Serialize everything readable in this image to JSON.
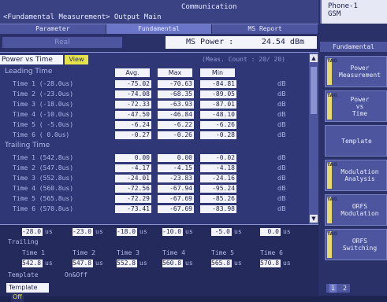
{
  "header": {
    "communication": "Communication",
    "title": "<Fundamental Measurement> Output Main",
    "phone_line1": "Phone-1",
    "phone_line2": "GSM"
  },
  "tabs": [
    "Parameter",
    "Fundamental",
    "MS Report"
  ],
  "ms_bar": {
    "box_label": "Real",
    "power_label": "MS Power :",
    "power_value": "24.54 dBm"
  },
  "main": {
    "pvt_label": "Power vs Time",
    "view_label": "View",
    "meas_count": "(Meas. Count :    20/  20)",
    "columns": [
      "Avg.",
      "Max",
      "Min"
    ],
    "leading_title": "Leading Time",
    "trailing_title": "Trailing Time",
    "unit": "dB",
    "leading_rows": [
      {
        "label": "Time 1 (-28.0us)",
        "avg": "-75.02",
        "max": "-70.63",
        "min": "-84.81"
      },
      {
        "label": "Time 2 (-23.0us)",
        "avg": "-74.08",
        "max": "-68.35",
        "min": "-89.05"
      },
      {
        "label": "Time 3 (-18.0us)",
        "avg": "-72.33",
        "max": "-63.93",
        "min": "-87.01"
      },
      {
        "label": "Time 4 (-10.0us)",
        "avg": "-47.50",
        "max": "-46.84",
        "min": "-48.10"
      },
      {
        "label": "Time 5 ( -5.0us)",
        "avg": "-6.24",
        "max": "-6.22",
        "min": "-6.26"
      },
      {
        "label": "Time 6 (  0.0us)",
        "avg": "-0.27",
        "max": "-0.26",
        "min": "-0.28"
      }
    ],
    "trailing_rows": [
      {
        "label": "Time 1 (542.8us)",
        "avg": "0.00",
        "max": "0.00",
        "min": "-0.02"
      },
      {
        "label": "Time 2 (547.8us)",
        "avg": "-4.17",
        "max": "-4.15",
        "min": "-4.18"
      },
      {
        "label": "Time 3 (552.8us)",
        "avg": "-24.01",
        "max": "-23.83",
        "min": "-24.16"
      },
      {
        "label": "Time 4 (560.8us)",
        "avg": "-72.56",
        "max": "-67.94",
        "min": "-95.24"
      },
      {
        "label": "Time 5 (565.8us)",
        "avg": "-72.29",
        "max": "-67.69",
        "min": "-85.26"
      },
      {
        "label": "Time 6 (570.8us)",
        "avg": "-73.41",
        "max": "-67.69",
        "min": "-83.98"
      }
    ]
  },
  "bottom": {
    "leading_values": [
      "-28.0",
      "-23.0",
      "-18.0",
      "-10.0",
      "-5.0",
      "0.0"
    ],
    "unit": "us",
    "trailing_title": "Trailing",
    "trailing_headers": [
      "Time 1",
      "Time 2",
      "Time 3",
      "Time 4",
      "Time 5",
      "Time 6"
    ],
    "trailing_values": [
      "542.8",
      "547.8",
      "552.8",
      "560.8",
      "565.8",
      "570.8"
    ],
    "template_label": "Template",
    "template_onoff": "On&Off",
    "template_button": "Template",
    "template_state": "Off"
  },
  "softkeys": {
    "mode": "Fundamental",
    "tag": "TAG",
    "keys": [
      "Power\nMeasurement",
      "Power\nvs\nTime",
      "Template",
      "Modulation\nAnalysis",
      "ORFS\nModulation",
      "ORFS\nSwitching"
    ],
    "pages": [
      "1",
      "2"
    ]
  }
}
